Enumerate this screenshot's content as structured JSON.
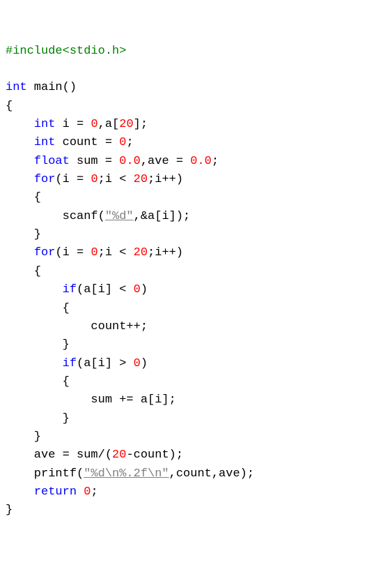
{
  "code": {
    "lines": [
      [
        {
          "t": "#include<stdio.h>",
          "c": "preproc"
        }
      ],
      [
        {
          "t": "",
          "c": "ident"
        }
      ],
      [
        {
          "t": "int",
          "c": "keyword"
        },
        {
          "t": " main()",
          "c": "ident"
        }
      ],
      [
        {
          "t": "{",
          "c": "punct"
        }
      ],
      [
        {
          "t": "    ",
          "c": "ident"
        },
        {
          "t": "int",
          "c": "keyword"
        },
        {
          "t": " i = ",
          "c": "ident"
        },
        {
          "t": "0",
          "c": "num"
        },
        {
          "t": ",a[",
          "c": "ident"
        },
        {
          "t": "20",
          "c": "num"
        },
        {
          "t": "];",
          "c": "ident"
        }
      ],
      [
        {
          "t": "    ",
          "c": "ident"
        },
        {
          "t": "int",
          "c": "keyword"
        },
        {
          "t": " count = ",
          "c": "ident"
        },
        {
          "t": "0",
          "c": "num"
        },
        {
          "t": ";",
          "c": "ident"
        }
      ],
      [
        {
          "t": "    ",
          "c": "ident"
        },
        {
          "t": "float",
          "c": "keyword"
        },
        {
          "t": " sum = ",
          "c": "ident"
        },
        {
          "t": "0.0",
          "c": "num"
        },
        {
          "t": ",ave = ",
          "c": "ident"
        },
        {
          "t": "0.0",
          "c": "num"
        },
        {
          "t": ";",
          "c": "ident"
        }
      ],
      [
        {
          "t": "    ",
          "c": "ident"
        },
        {
          "t": "for",
          "c": "keyword"
        },
        {
          "t": "(i = ",
          "c": "ident"
        },
        {
          "t": "0",
          "c": "num"
        },
        {
          "t": ";i < ",
          "c": "ident"
        },
        {
          "t": "20",
          "c": "num"
        },
        {
          "t": ";i++)",
          "c": "ident"
        }
      ],
      [
        {
          "t": "    {",
          "c": "punct"
        }
      ],
      [
        {
          "t": "        scanf(",
          "c": "ident"
        },
        {
          "t": "\"%d\"",
          "c": "str"
        },
        {
          "t": ",&a[i]);",
          "c": "ident"
        }
      ],
      [
        {
          "t": "    }",
          "c": "punct"
        }
      ],
      [
        {
          "t": "    ",
          "c": "ident"
        },
        {
          "t": "for",
          "c": "keyword"
        },
        {
          "t": "(i = ",
          "c": "ident"
        },
        {
          "t": "0",
          "c": "num"
        },
        {
          "t": ";i < ",
          "c": "ident"
        },
        {
          "t": "20",
          "c": "num"
        },
        {
          "t": ";i++)",
          "c": "ident"
        }
      ],
      [
        {
          "t": "    {",
          "c": "punct"
        }
      ],
      [
        {
          "t": "        ",
          "c": "ident"
        },
        {
          "t": "if",
          "c": "keyword"
        },
        {
          "t": "(a[i] < ",
          "c": "ident"
        },
        {
          "t": "0",
          "c": "num"
        },
        {
          "t": ")",
          "c": "ident"
        }
      ],
      [
        {
          "t": "        {",
          "c": "punct"
        }
      ],
      [
        {
          "t": "            count++;",
          "c": "ident"
        }
      ],
      [
        {
          "t": "        }",
          "c": "punct"
        }
      ],
      [
        {
          "t": "        ",
          "c": "ident"
        },
        {
          "t": "if",
          "c": "keyword"
        },
        {
          "t": "(a[i] > ",
          "c": "ident"
        },
        {
          "t": "0",
          "c": "num"
        },
        {
          "t": ")",
          "c": "ident"
        }
      ],
      [
        {
          "t": "        {",
          "c": "punct"
        }
      ],
      [
        {
          "t": "            sum += a[i];",
          "c": "ident"
        }
      ],
      [
        {
          "t": "        }",
          "c": "punct"
        }
      ],
      [
        {
          "t": "    }",
          "c": "punct"
        }
      ],
      [
        {
          "t": "    ave = sum/(",
          "c": "ident"
        },
        {
          "t": "20",
          "c": "num"
        },
        {
          "t": "-count);",
          "c": "ident"
        }
      ],
      [
        {
          "t": "    printf(",
          "c": "ident"
        },
        {
          "t": "\"%d\\n%.2f\\n\"",
          "c": "str"
        },
        {
          "t": ",count,ave);",
          "c": "ident"
        }
      ],
      [
        {
          "t": "    ",
          "c": "ident"
        },
        {
          "t": "return",
          "c": "keyword"
        },
        {
          "t": " ",
          "c": "ident"
        },
        {
          "t": "0",
          "c": "num"
        },
        {
          "t": ";",
          "c": "ident"
        }
      ],
      [
        {
          "t": "}",
          "c": "punct"
        }
      ]
    ]
  }
}
